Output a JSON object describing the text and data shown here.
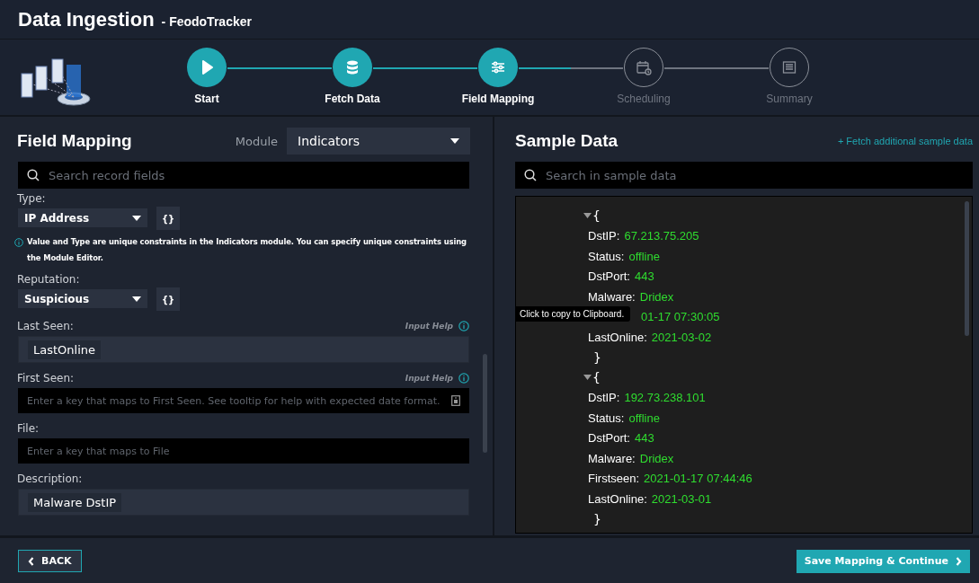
{
  "header": {
    "title": "Data Ingestion",
    "subtitle": "- FeodoTracker"
  },
  "steps": [
    {
      "label": "Start",
      "active": true
    },
    {
      "label": "Fetch Data",
      "active": true
    },
    {
      "label": "Field Mapping",
      "active": true
    },
    {
      "label": "Scheduling",
      "active": false
    },
    {
      "label": "Summary",
      "active": false
    }
  ],
  "field_mapping": {
    "title": "Field Mapping",
    "module_label": "Module",
    "module_value": "Indicators",
    "search": {
      "placeholder": "Search record fields"
    },
    "fields": [
      {
        "kind": "select",
        "label": "Type:",
        "value": "IP Address",
        "expr_button": "{}"
      },
      {
        "kind": "note",
        "text": "**Value** and **Type** are unique constraints in the Indicators module. You can specify unique constraints using the Module Editor."
      },
      {
        "kind": "select",
        "label": "Reputation:",
        "value": "Suspicious",
        "expr_button": "{}"
      },
      {
        "kind": "tag",
        "label": "Last Seen:",
        "help": "Input Help",
        "value": "LastOnline"
      },
      {
        "kind": "text",
        "label": "First Seen:",
        "help": "Input Help",
        "placeholder": "Enter a key that maps to First Seen. See tooltip for help with expected date format.",
        "picker": true
      },
      {
        "kind": "text",
        "label": "File:",
        "placeholder": "Enter a key that maps to File",
        "picker": false
      },
      {
        "kind": "tag",
        "label": "Description:",
        "value": "Malware DstIP"
      }
    ]
  },
  "sample_data": {
    "title": "Sample Data",
    "fetch_link": "+ Fetch additional sample data",
    "search": {
      "placeholder": "Search in sample data"
    },
    "records": [
      {
        "expanded": true,
        "open": "{",
        "close": "}",
        "entries": [
          {
            "key": "DstIP:",
            "value": "67.213.75.205"
          },
          {
            "key": "Status:",
            "value": "offline"
          },
          {
            "key": "DstPort:",
            "value": "443"
          },
          {
            "key": "Malware:",
            "value": "Dridex"
          },
          {
            "value": "01-17 07:30:05",
            "tooltip": "Click to copy to Clipboard."
          },
          {
            "key": "LastOnline:",
            "value": "2021-03-02"
          }
        ]
      },
      {
        "expanded": true,
        "open": "{",
        "close": "}",
        "entries": [
          {
            "key": "DstIP:",
            "value": "192.73.238.101"
          },
          {
            "key": "Status:",
            "value": "offline"
          },
          {
            "key": "DstPort:",
            "value": "443"
          },
          {
            "key": "Malware:",
            "value": "Dridex"
          },
          {
            "key": "Firstseen:",
            "value": "2021-01-17 07:44:46"
          },
          {
            "key": "LastOnline:",
            "value": "2021-03-01"
          }
        ]
      }
    ]
  },
  "footer": {
    "back": "BACK",
    "continue": "Save Mapping & Continue"
  }
}
